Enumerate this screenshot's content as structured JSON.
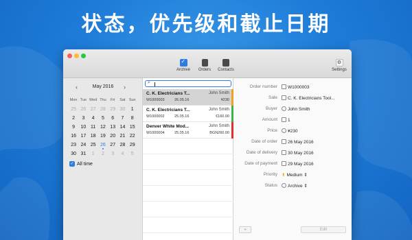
{
  "headline": "状态，优先级和截止日期",
  "toolbar": {
    "archive_label": "Archive",
    "orders_label": "Orders",
    "contacts_label": "Contacts",
    "settings_label": "Settings",
    "settings_glyph": "⚙"
  },
  "calendar": {
    "prev": "‹",
    "next": "›",
    "month": "May 2016",
    "dows": [
      "Mon",
      "Tue",
      "Wed",
      "Thu",
      "Fri",
      "Sat",
      "Sun"
    ],
    "weeks": [
      [
        "25",
        "26",
        "27",
        "28",
        "29",
        "30",
        "1"
      ],
      [
        "2",
        "3",
        "4",
        "5",
        "6",
        "7",
        "8"
      ],
      [
        "9",
        "10",
        "11",
        "12",
        "13",
        "14",
        "15"
      ],
      [
        "16",
        "17",
        "18",
        "19",
        "20",
        "21",
        "22"
      ],
      [
        "23",
        "24",
        "25",
        "26",
        "27",
        "28",
        "29"
      ],
      [
        "30",
        "31",
        "1",
        "2",
        "3",
        "4",
        "5"
      ]
    ],
    "all_time_label": "All time",
    "all_time_checked": true
  },
  "search": {
    "placeholder": "",
    "icon": "🔍"
  },
  "orders": [
    {
      "title": "C. K. Electricians T...",
      "client": "John Smith",
      "number": "W1000003",
      "date": "26.05.16",
      "amount": "¥230",
      "status_color": "#f0a020",
      "selected": true
    },
    {
      "title": "C. K. Electricians T...",
      "client": "John Smith",
      "number": "W1000002",
      "date": "25.05.16",
      "amount": "€160.00",
      "status_color": "#3cb44b",
      "selected": false
    },
    {
      "title": "Denver White Mod...",
      "client": "John Smith",
      "number": "W1000004",
      "date": "25.05.16",
      "amount": "BGN260.00",
      "status_color": "#e03030",
      "selected": false
    }
  ],
  "detail": {
    "order_number_label": "Order number",
    "order_number": "W1000003",
    "sale_label": "Sale",
    "sale": "C. K. Electricians Tool...",
    "buyer_label": "Buyer",
    "buyer": "John Smith",
    "amount_label": "Amount",
    "amount": "1",
    "price_label": "Price",
    "price": "¥230",
    "date_order_label": "Date of order",
    "date_order": "26 May 2016",
    "date_delivery_label": "Date of delivery",
    "date_delivery": "30 May 2016",
    "date_payment_label": "Date of payment",
    "date_payment": "29 May 2016",
    "priority_label": "Priority",
    "priority": "Medium",
    "status_label": "Status",
    "status": "Archive",
    "add_label": "+",
    "edit_label": "Edit"
  }
}
